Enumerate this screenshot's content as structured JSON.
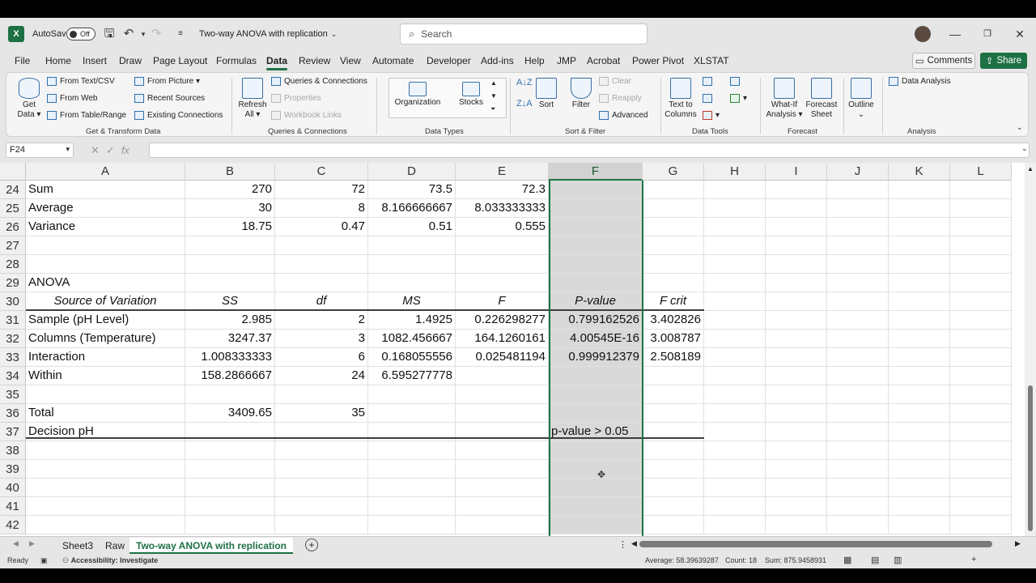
{
  "titlebar": {
    "autosave_label": "AutoSave",
    "autosave_state": "Off",
    "file_title": "Two-way ANOVA with replication",
    "search_placeholder": "Search"
  },
  "menu": [
    "File",
    "Home",
    "Insert",
    "Draw",
    "Page Layout",
    "Formulas",
    "Data",
    "Review",
    "View",
    "Automate",
    "Developer",
    "Add-ins",
    "Help",
    "JMP",
    "Acrobat",
    "Power Pivot",
    "XLSTAT"
  ],
  "active_menu": "Data",
  "comments_label": "Comments",
  "share_label": "Share",
  "ribbon": {
    "get_data": "Get Data",
    "from_text_csv": "From Text/CSV",
    "from_web": "From Web",
    "from_table_range": "From Table/Range",
    "from_picture": "From Picture",
    "recent_sources": "Recent Sources",
    "existing_connections": "Existing Connections",
    "group_get_transform": "Get & Transform Data",
    "refresh_all": "Refresh All",
    "queries_connections": "Queries & Connections",
    "properties": "Properties",
    "workbook_links": "Workbook Links",
    "group_queries": "Queries & Connections",
    "organization": "Organization",
    "stocks": "Stocks",
    "group_data_types": "Data Types",
    "sort": "Sort",
    "filter": "Filter",
    "clear": "Clear",
    "reapply": "Reapply",
    "advanced": "Advanced",
    "group_sort_filter": "Sort & Filter",
    "text_to_columns": "Text to Columns",
    "group_data_tools": "Data Tools",
    "what_if": "What-If Analysis",
    "forecast_sheet": "Forecast Sheet",
    "group_forecast": "Forecast",
    "outline": "Outline",
    "data_analysis": "Data Analysis",
    "group_analysis": "Analysis"
  },
  "namebox": "F24",
  "columns": [
    "A",
    "B",
    "C",
    "D",
    "E",
    "F",
    "G",
    "H",
    "I",
    "J",
    "K",
    "L"
  ],
  "rows": [
    {
      "n": "24",
      "cells": [
        "Sum",
        "270",
        "72",
        "73.5",
        "72.3",
        "",
        ""
      ]
    },
    {
      "n": "25",
      "cells": [
        "Average",
        "30",
        "8",
        "8.166666667",
        "8.033333333",
        "",
        ""
      ]
    },
    {
      "n": "26",
      "cells": [
        "Variance",
        "18.75",
        "0.47",
        "0.51",
        "0.555",
        "",
        ""
      ]
    },
    {
      "n": "27",
      "cells": [
        "",
        "",
        "",
        "",
        "",
        "",
        ""
      ]
    },
    {
      "n": "28",
      "cells": [
        "",
        "",
        "",
        "",
        "",
        "",
        ""
      ]
    },
    {
      "n": "29",
      "cells": [
        "ANOVA",
        "",
        "",
        "",
        "",
        "",
        ""
      ]
    },
    {
      "n": "30",
      "cells": [
        "Source of Variation",
        "SS",
        "df",
        "MS",
        "F",
        "P-value",
        "F crit"
      ]
    },
    {
      "n": "31",
      "cells": [
        "Sample (pH Level)",
        "2.985",
        "2",
        "1.4925",
        "0.226298277",
        "0.799162526",
        "3.402826"
      ]
    },
    {
      "n": "32",
      "cells": [
        "Columns (Temperature)",
        "3247.37",
        "3",
        "1082.456667",
        "164.1260161",
        "4.00545E-16",
        "3.008787"
      ]
    },
    {
      "n": "33",
      "cells": [
        "Interaction",
        "1.008333333",
        "6",
        "0.168055556",
        "0.025481194",
        "0.999912379",
        "2.508189"
      ]
    },
    {
      "n": "34",
      "cells": [
        "Within",
        "158.2866667",
        "24",
        "6.595277778",
        "",
        "",
        ""
      ]
    },
    {
      "n": "35",
      "cells": [
        "",
        "",
        "",
        "",
        "",
        "",
        ""
      ]
    },
    {
      "n": "36",
      "cells": [
        "Total",
        "3409.65",
        "35",
        "",
        "",
        "",
        ""
      ]
    },
    {
      "n": "37",
      "cells": [
        "Decision pH",
        "",
        "",
        "",
        "",
        "p-value > 0.05",
        ""
      ]
    },
    {
      "n": "38",
      "cells": [
        "",
        "",
        "",
        "",
        "",
        "",
        ""
      ]
    },
    {
      "n": "39",
      "cells": [
        "",
        "",
        "",
        "",
        "",
        "",
        ""
      ]
    },
    {
      "n": "40",
      "cells": [
        "",
        "",
        "",
        "",
        "",
        "",
        ""
      ]
    },
    {
      "n": "41",
      "cells": [
        "",
        "",
        "",
        "",
        "",
        "",
        ""
      ]
    },
    {
      "n": "42",
      "cells": [
        "",
        "",
        "",
        "",
        "",
        "",
        ""
      ]
    }
  ],
  "sheet_tabs": [
    "Sheet3",
    "Raw",
    "Two-way ANOVA with replication"
  ],
  "active_sheet": "Two-way ANOVA with replication",
  "status": {
    "ready": "Ready",
    "accessibility": "Accessibility: Investigate",
    "average": "Average: 58.39639287",
    "count": "Count: 18",
    "sum": "Sum: 875.9458931"
  },
  "colors": {
    "accent": "#1e7145",
    "selection": "#d9d9d9"
  }
}
